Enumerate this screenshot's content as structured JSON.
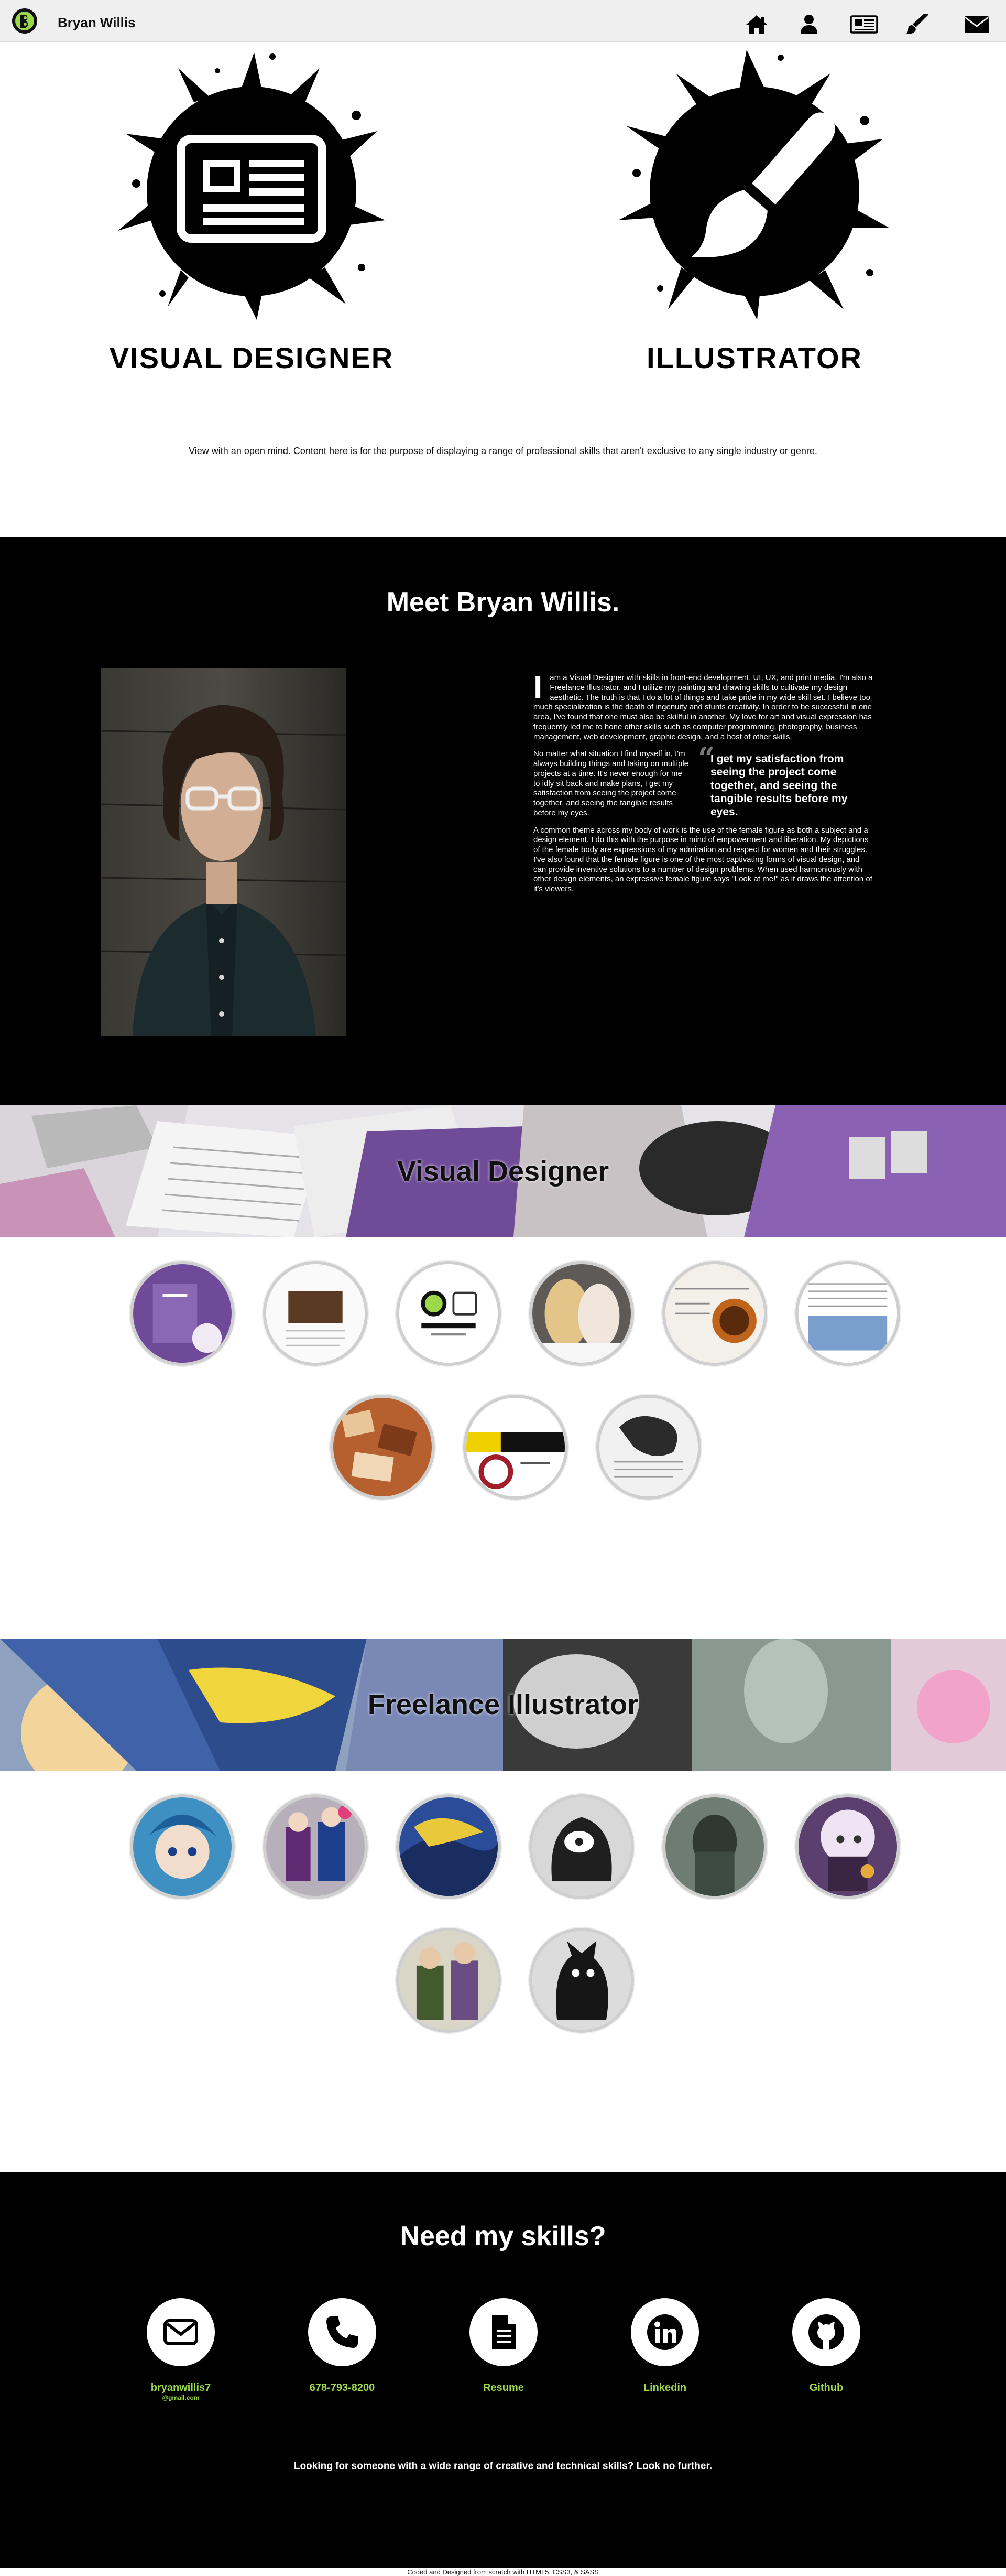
{
  "nav": {
    "brand": "Bryan Willis",
    "icons": [
      "home-icon",
      "user-icon",
      "newspaper-icon",
      "brush-icon",
      "envelope-icon"
    ]
  },
  "hero": {
    "designer_title": "VISUAL DESIGNER",
    "illustrator_title": "ILLUSTRATOR",
    "description": "View with an open mind. Content here is for the purpose of displaying a range of professional skills that aren't exclusive to any single industry or genre."
  },
  "about": {
    "title": "Meet Bryan Willis.",
    "dropcap": "I",
    "p1": "am a Visual Designer with skills in front-end development, UI, UX, and print media. I'm also a Freelance Illustrator, and I utilize my painting and drawing skills to cultivate my design aesthetic. The truth is that I do a lot of things and take pride in my wide skill set. I believe too much specialization is the death of ingenuity and stunts creativity. In order to be successful in one area, I've found that one must also be skillful in another. My love for art and visual expression has frequently led me to hone other skills such as computer programming, photography, business management, web development, graphic design, and a host of other skills.",
    "p2": "No matter what situation I find myself in, I'm always building things and taking on multiple projects at a time. It's never enough for me to idly sit back and make plans, I get my satisfaction from seeing the project come together, and seeing the tangible results before my eyes.",
    "quote": "I get my satisfaction from seeing the project come together, and seeing the tangible results before my eyes.",
    "p3": "A common theme across my body of work is the use of the female figure as both a subject and a design element. I do this with the purpose in mind of empowerment and liberation. My depictions of the female body are expressions of my admiration and respect for women and their struggles. I've also found that the female figure is one of the most captivating forms of visual design, and can provide inventive solutions to a number of design problems. When used harmoniously with other design elements, an expressive female figure says \"Look at me!\" as it draws the attention of it's viewers."
  },
  "designer_section": {
    "title": "Visual Designer"
  },
  "illustrator_section": {
    "title": "Freelance Illustrator"
  },
  "contact": {
    "title": "Need my skills?",
    "items": [
      {
        "icon": "envelope-icon",
        "label": "bryanwillis7",
        "sub": "@gmail.com"
      },
      {
        "icon": "phone-icon",
        "label": "678-793-8200"
      },
      {
        "icon": "document-icon",
        "label": "Resume"
      },
      {
        "icon": "linkedin-icon",
        "label": "Linkedin"
      },
      {
        "icon": "github-icon",
        "label": "Github"
      }
    ],
    "tagline": "Looking for someone with a wide range of creative and technical skills? Look no further.",
    "accent": "#9bd84a"
  },
  "footer": {
    "text": "Coded and Designed from scratch with HTML5, CSS3, & SASS"
  }
}
